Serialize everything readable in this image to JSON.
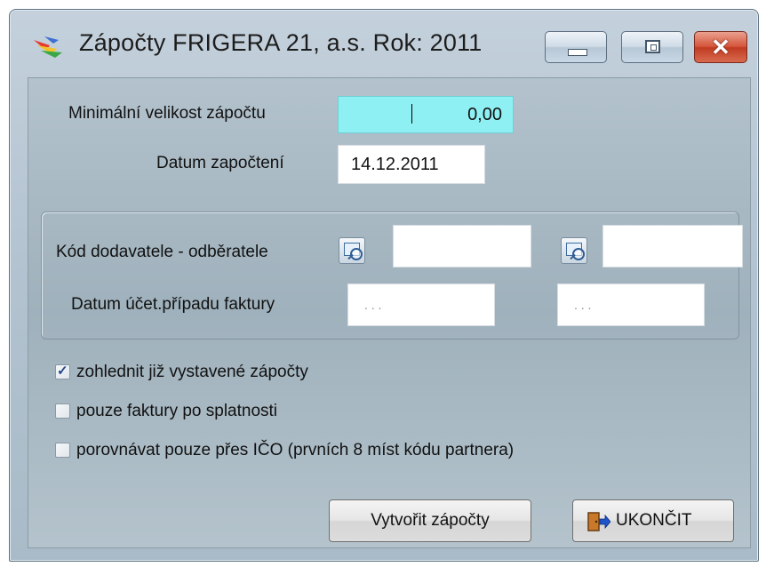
{
  "window": {
    "title": "Zápočty  FRIGERA 21, a.s.  Rok: 2011",
    "close_glyph": "✕"
  },
  "form": {
    "min_size_label": "Minimální velikost zápočtu",
    "min_size_value": "0,00",
    "date_label": "Datum započtení",
    "date_value": "14.12.2011",
    "code_label": "Kód dodavatele - odběratele",
    "code_from_value": "",
    "code_to_value": "",
    "invoice_date_label": "Datum  účet.případu faktury",
    "invoice_date_from_placeholder": ". . .",
    "invoice_date_to_placeholder": ". . ."
  },
  "options": [
    {
      "label": "zohlednit již vystavené zápočty",
      "checked": true
    },
    {
      "label": "pouze faktury po splatnosti",
      "checked": false
    },
    {
      "label": "porovnávat pouze přes IČO (prvních 8 míst kódu partnera)",
      "checked": false
    }
  ],
  "buttons": {
    "create_label": "Vytvořit zápočty",
    "exit_label": "UKONČIT"
  },
  "colors": {
    "highlight_field": "#8ff0f3",
    "close_button": "#c03c22"
  },
  "icons": {
    "app": "coins-icon",
    "lookup": "lookup-icon",
    "exit": "exit-door-icon",
    "check": "checkmark-icon"
  }
}
